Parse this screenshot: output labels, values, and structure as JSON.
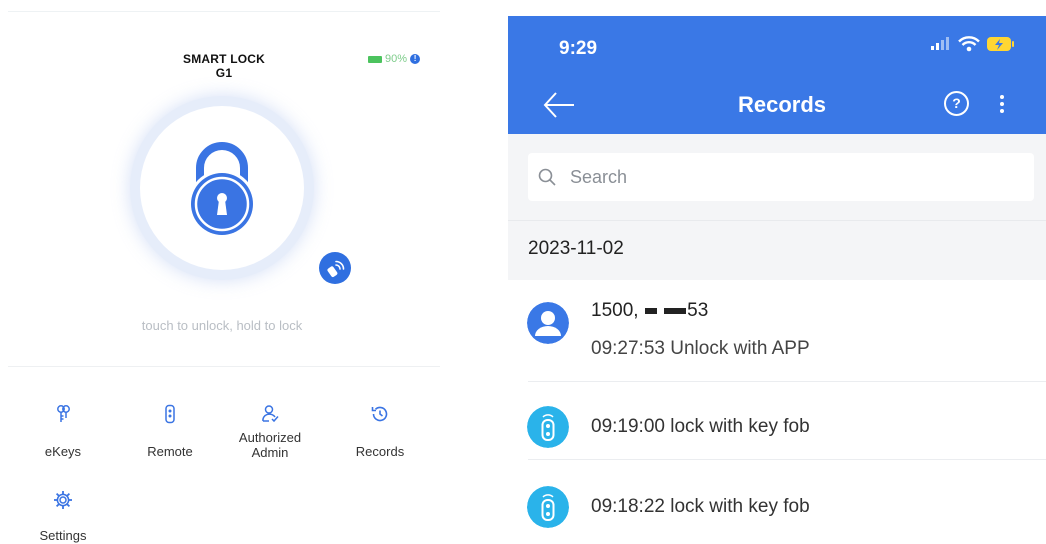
{
  "lock_screen": {
    "title": "SMART LOCK G1",
    "battery_text": "90%",
    "battery_color": "#4cc35e",
    "accent_color": "#2f6fe0",
    "info_glyph": "!",
    "hint": "touch to unlock, hold to lock",
    "menu": [
      {
        "label": "eKeys",
        "icon": "ekeys-icon"
      },
      {
        "label": "Remote",
        "icon": "remote-icon"
      },
      {
        "label_line1": "Authorized",
        "label_line2": "Admin",
        "icon": "authorized-admin-icon"
      },
      {
        "label": "Records",
        "icon": "records-icon"
      },
      {
        "label": "Settings",
        "icon": "settings-icon"
      }
    ]
  },
  "records_screen": {
    "status_bar": {
      "time": "9:29"
    },
    "appbar": {
      "title": "Records",
      "help_glyph": "?",
      "bg_color": "#3a78e6"
    },
    "search": {
      "placeholder": "Search"
    },
    "groups": [
      {
        "date": "2023-11-02",
        "records": [
          {
            "user_prefix": "1500",
            "user_suffix": "53",
            "text": "09:27:53 Unlock with APP",
            "icon": "user-avatar-icon"
          },
          {
            "text": "09:19:00 lock with key fob",
            "icon": "key-fob-icon"
          },
          {
            "text": "09:18:22 lock with key fob",
            "icon": "key-fob-icon"
          }
        ]
      }
    ]
  }
}
